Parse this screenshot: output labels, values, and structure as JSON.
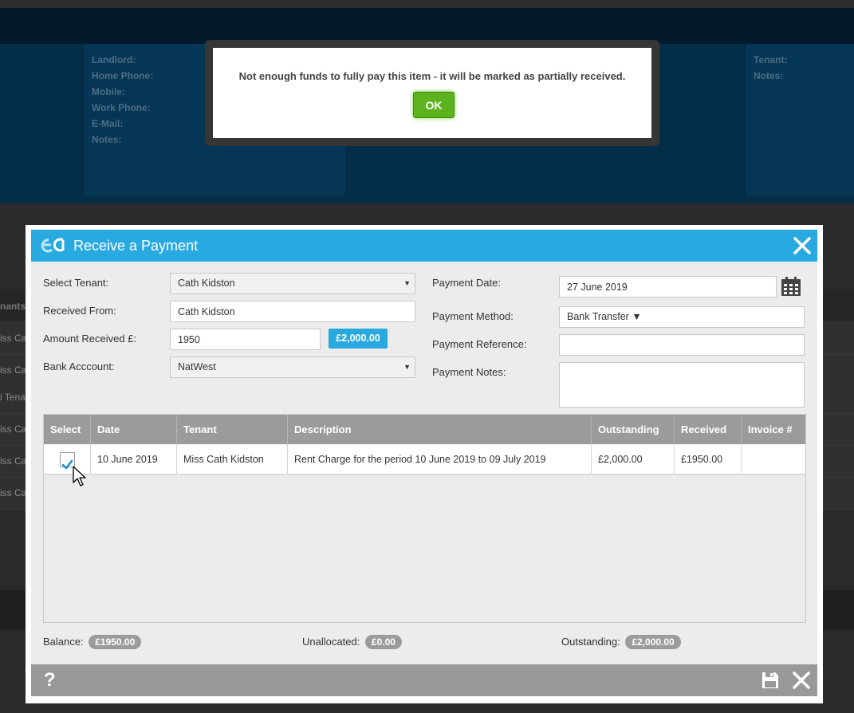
{
  "background": {
    "labels": [
      "Landlord:",
      "Home Phone:",
      "Mobile:",
      "Work Phone:",
      "E-Mail:",
      "Notes:"
    ],
    "right_labels": [
      "Tenant:",
      "Notes:"
    ],
    "grid_header": "nants",
    "grid_rows": [
      "iss Ca",
      "iss Ca",
      "i Tena",
      "iss Ca",
      "iss Ca",
      "iss Ca"
    ]
  },
  "alert": {
    "message": "Not enough funds to fully pay this item - it will be marked as partially received.",
    "ok_label": "OK"
  },
  "modal": {
    "title": "Receive a Payment",
    "logo_icon": "ea-logo-icon",
    "close_icon": "close-icon"
  },
  "form": {
    "select_tenant_label": "Select Tenant:",
    "select_tenant_value": "Cath Kidston",
    "received_from_label": "Received From:",
    "received_from_value": "Cath Kidston",
    "amount_label": "Amount Received £:",
    "amount_value": "1950",
    "amount_badge": "£2,000.00",
    "bank_account_label": "Bank Acccount:",
    "bank_account_value": "NatWest",
    "payment_date_label": "Payment Date:",
    "payment_date_value": "27 June 2019",
    "payment_method_label": "Payment Method:",
    "payment_method_value": "Bank Transfer",
    "payment_reference_label": "Payment Reference:",
    "payment_reference_value": "",
    "payment_notes_label": "Payment Notes:",
    "payment_notes_value": ""
  },
  "table": {
    "columns": [
      "Select",
      "Date",
      "Tenant",
      "Description",
      "Outstanding",
      "Received",
      "Invoice #"
    ],
    "rows": [
      {
        "selected": true,
        "date": "10 June 2019",
        "tenant": "Miss Cath Kidston",
        "description": "Rent Charge for the period 10 June 2019 to 09 July 2019",
        "outstanding": "£2,000.00",
        "received": "£1950.00",
        "invoice": ""
      }
    ]
  },
  "totals": {
    "balance_label": "Balance:",
    "balance_value": "£1950.00",
    "unallocated_label": "Unallocated:",
    "unallocated_value": "£0.00",
    "outstanding_label": "Outstanding:",
    "outstanding_value": "£2,000.00"
  },
  "footer": {
    "help_label": "?",
    "colors": {
      "header": "#28a9df",
      "footer": "#999999",
      "ok_button": "#5cb31e"
    }
  }
}
